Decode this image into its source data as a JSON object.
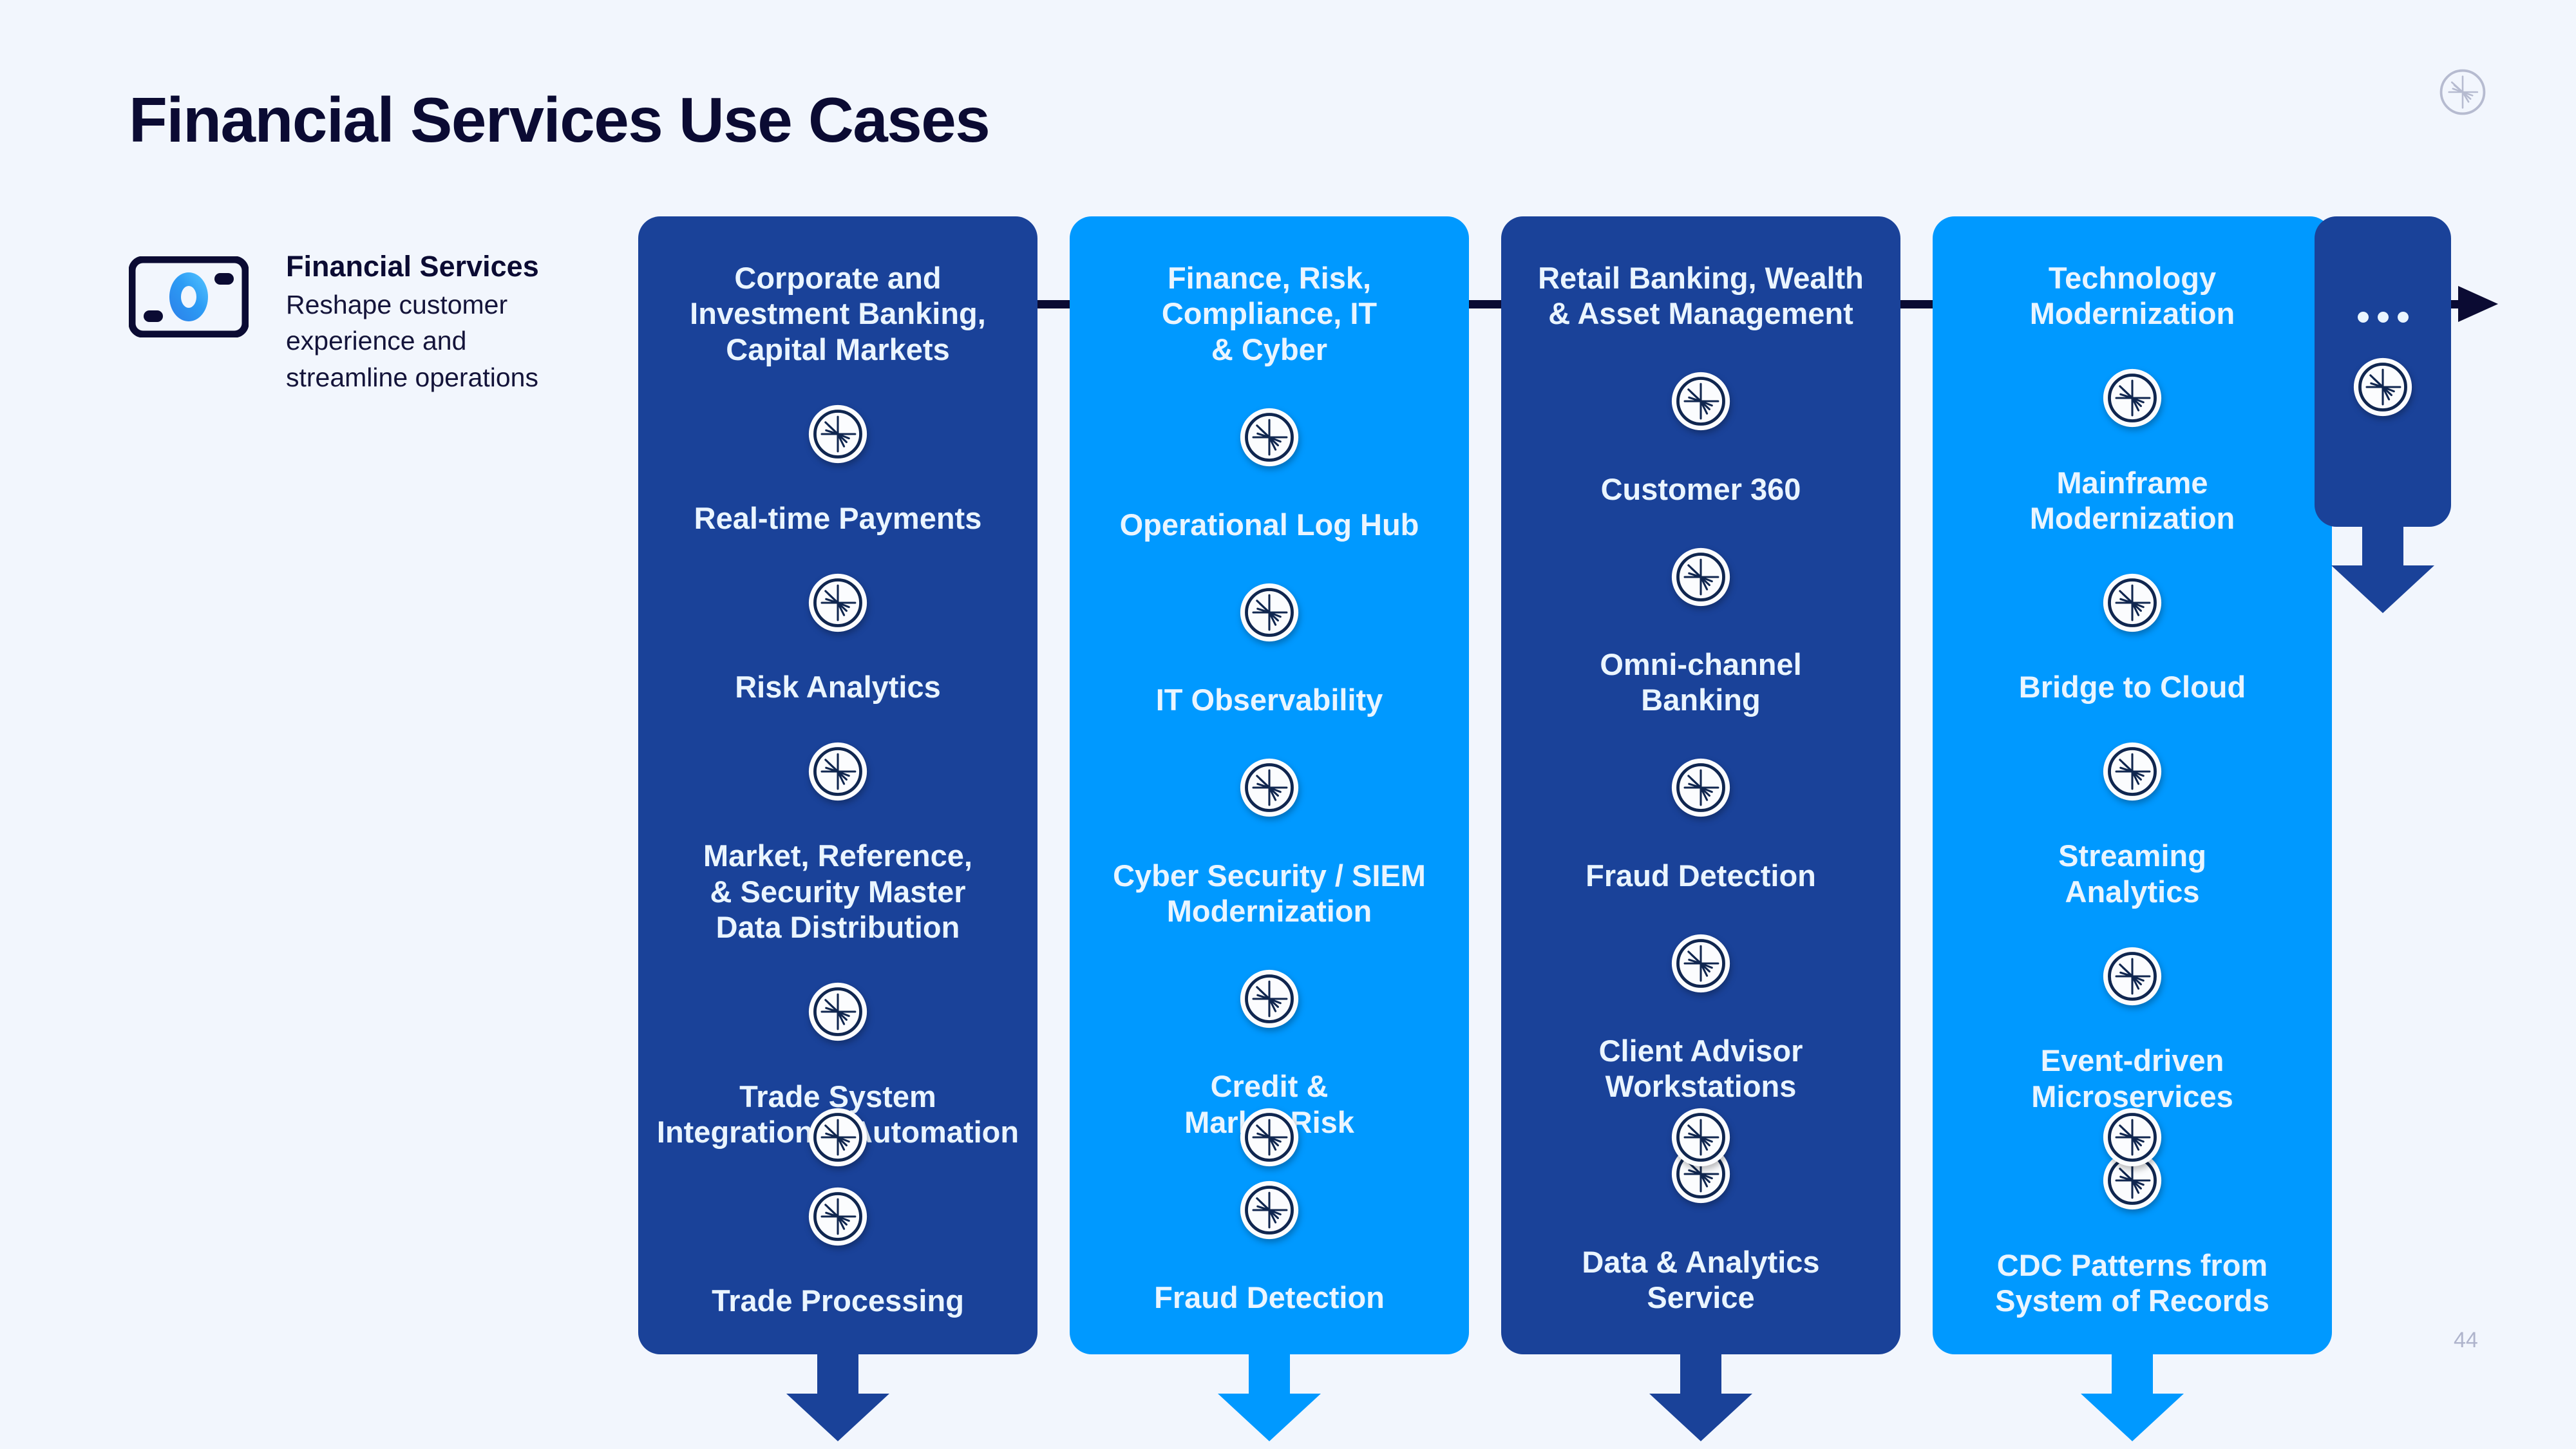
{
  "page": {
    "title": "Financial Services Use Cases",
    "page_number": "44",
    "background_color": "#F2F6FD",
    "title_color": "#0B0B33"
  },
  "logo": {
    "name": "starburst-logo",
    "color": "#B6BBD0"
  },
  "legend": {
    "icon_name": "financial-services-icon",
    "title": "Financial Services",
    "description": "Reshape customer experience and streamline operations"
  },
  "colors": {
    "dark_blue": "#1A4299",
    "light_blue": "#0099FF",
    "connector": "#0B0B33",
    "card_text": "#EAF5FF"
  },
  "flow": {
    "more_label": "•••",
    "more_dots_count": 3
  },
  "columns": [
    {
      "theme": "dark",
      "header": "Corporate and Investment Banking, Capital Markets",
      "header_lines": [
        "Corporate and",
        "Investment Banking,",
        "Capital Markets"
      ],
      "items": [
        {
          "label": "Real-time Payments",
          "lines": [
            "Real-time Payments"
          ]
        },
        {
          "label": "Risk Analytics",
          "lines": [
            "Risk Analytics"
          ]
        },
        {
          "label": "Market, Reference, & Security Master Data Distribution",
          "lines": [
            "Market, Reference,",
            "& Security Master",
            "Data Distribution"
          ]
        },
        {
          "label": "Trade System Integration & Automation",
          "lines": [
            "Trade System",
            "Integration & Automation"
          ]
        },
        {
          "label": "Trade Processing",
          "lines": [
            "Trade Processing"
          ]
        }
      ]
    },
    {
      "theme": "light",
      "header": "Finance, Risk, Compliance, IT & Cyber",
      "header_lines": [
        "Finance, Risk,",
        "Compliance, IT",
        "& Cyber"
      ],
      "items": [
        {
          "label": "Operational Log Hub",
          "lines": [
            "Operational Log Hub"
          ]
        },
        {
          "label": "IT Observability",
          "lines": [
            "IT Observability"
          ]
        },
        {
          "label": "Cyber Security / SIEM Modernization",
          "lines": [
            "Cyber Security / SIEM",
            "Modernization"
          ]
        },
        {
          "label": "Credit & Market Risk",
          "lines": [
            "Credit &",
            "Market Risk"
          ]
        },
        {
          "label": "Fraud Detection",
          "lines": [
            "Fraud Detection"
          ]
        }
      ]
    },
    {
      "theme": "dark",
      "header": "Retail Banking, Wealth & Asset Management",
      "header_lines": [
        "Retail Banking, Wealth",
        "& Asset Management"
      ],
      "items": [
        {
          "label": "Customer 360",
          "lines": [
            "Customer 360"
          ]
        },
        {
          "label": "Omni-channel Banking",
          "lines": [
            "Omni-channel",
            "Banking"
          ]
        },
        {
          "label": "Fraud Detection",
          "lines": [
            "Fraud Detection"
          ]
        },
        {
          "label": "Client Advisor Workstations",
          "lines": [
            "Client Advisor",
            "Workstations"
          ]
        },
        {
          "label": "Data & Analytics Service",
          "lines": [
            "Data & Analytics",
            "Service"
          ]
        }
      ]
    },
    {
      "theme": "light",
      "header": "Technology Modernization",
      "header_lines": [
        "Technology",
        "Modernization"
      ],
      "items": [
        {
          "label": "Mainframe Modernization",
          "lines": [
            "Mainframe",
            "Modernization"
          ]
        },
        {
          "label": "Bridge to Cloud",
          "lines": [
            "Bridge to Cloud"
          ]
        },
        {
          "label": "Streaming Analytics",
          "lines": [
            "Streaming",
            "Analytics"
          ]
        },
        {
          "label": "Event-driven Microservices",
          "lines": [
            "Event-driven",
            "Microservices"
          ]
        },
        {
          "label": "CDC Patterns from System of Records",
          "lines": [
            "CDC Patterns from",
            "System of Records"
          ]
        }
      ]
    }
  ]
}
